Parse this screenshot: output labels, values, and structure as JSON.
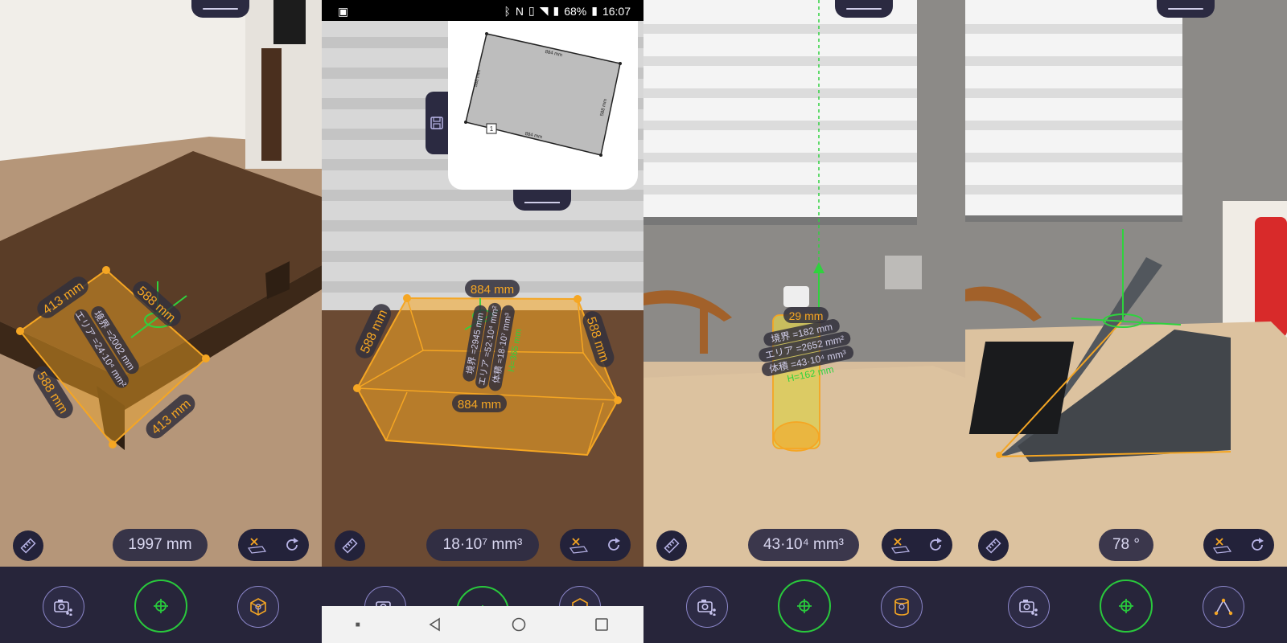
{
  "panels": [
    {
      "readout": "1997 mm",
      "labels": {
        "top_left": "413 mm",
        "top_right": "588 mm",
        "bottom_left": "588 mm",
        "bottom_right": "413 mm",
        "perimeter": "境界 =2002 mm",
        "area": "エリア =24·10⁴ mm²"
      }
    },
    {
      "readout": "18·10⁷ mm³",
      "labels": {
        "top": "884 mm",
        "left": "588 mm",
        "right": "588 mm",
        "front": "884 mm",
        "perimeter": "境界 =2945 mm",
        "area": "エリア =52·10⁴ mm²",
        "volume": "体積 =18·10⁷ mm³",
        "height": "H=365 mm"
      },
      "status": {
        "battery": "68%",
        "time": "16:07"
      },
      "floorplan": {
        "side_top": "884 mm",
        "side_bottom": "884 mm",
        "side_left": "588 mm",
        "side_right": "588 mm",
        "corner_marker": "1"
      }
    },
    {
      "readout": "43·10⁴ mm³",
      "labels": {
        "diameter": "29 mm",
        "perimeter": "境界 =182 mm",
        "area": "エリア =2652 mm²",
        "volume": "体積 =43·10⁴ mm³",
        "height": "H=162 mm"
      }
    },
    {
      "readout": "78 °",
      "labels": {}
    }
  ],
  "colors": {
    "accent_orange": "#f5a623",
    "accent_green": "#2fd23e",
    "bar_bg": "#27253a",
    "pill_bg": "#23223a"
  },
  "icons": [
    "ruler-icon",
    "clear-plane-icon",
    "undo-icon",
    "camera-share-icon",
    "crosshair-icon",
    "cube-icon",
    "cylinder-icon",
    "angle-icon",
    "save-icon"
  ]
}
